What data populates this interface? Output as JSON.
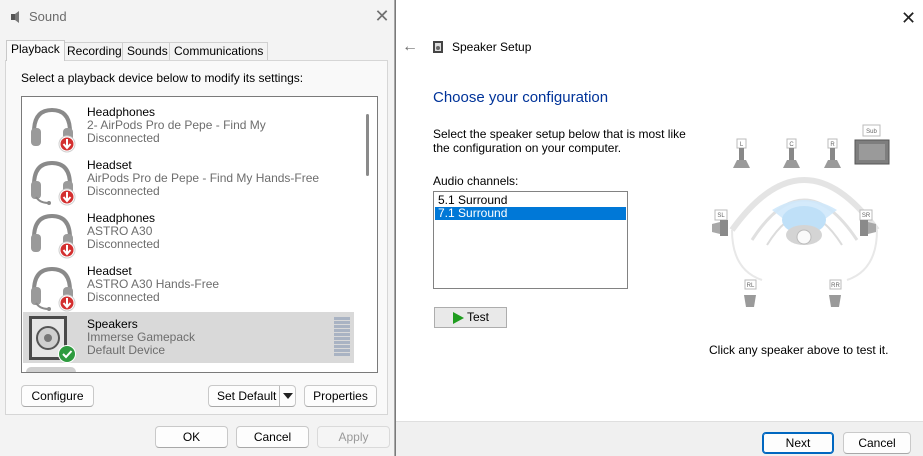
{
  "sound_dialog": {
    "title": "Sound",
    "tabs": [
      "Playback",
      "Recording",
      "Sounds",
      "Communications"
    ],
    "instruction": "Select a playback device below to modify its settings:",
    "devices": [
      {
        "name": "Headphones",
        "detail": "2- AirPods Pro de Pepe - Find My",
        "status": "Disconnected",
        "icon": "headphones-icon",
        "badge": "disconnected-badge"
      },
      {
        "name": "Headset",
        "detail": "AirPods Pro de Pepe - Find My Hands-Free",
        "status": "Disconnected",
        "icon": "headset-icon",
        "badge": "disconnected-badge"
      },
      {
        "name": "Headphones",
        "detail": "ASTRO A30",
        "status": "Disconnected",
        "icon": "headphones-icon",
        "badge": "disconnected-badge"
      },
      {
        "name": "Headset",
        "detail": "ASTRO A30 Hands-Free",
        "status": "Disconnected",
        "icon": "headset-icon",
        "badge": "disconnected-badge"
      },
      {
        "name": "Speakers",
        "detail": "Immerse Gamepack",
        "status": "Default Device",
        "icon": "speakers-icon",
        "badge": "default-check-badge",
        "selected": true
      }
    ],
    "buttons": {
      "configure": "Configure",
      "set_default": "Set Default",
      "properties": "Properties",
      "ok": "OK",
      "cancel": "Cancel",
      "apply": "Apply"
    }
  },
  "speaker_setup": {
    "header_title": "Speaker Setup",
    "heading": "Choose your configuration",
    "description": "Select the speaker setup below that is most like the configuration on your computer.",
    "channels_label": "Audio channels:",
    "channels": [
      {
        "label": "5.1 Surround",
        "selected": false
      },
      {
        "label": "7.1 Surround",
        "selected": true
      }
    ],
    "test_label": "Test",
    "hint": "Click any speaker above to test it.",
    "speaker_labels": {
      "L": "L",
      "C": "C",
      "R": "R",
      "Sub": "Sub",
      "SL": "SL",
      "SR": "SR",
      "RL": "RL",
      "RR": "RR"
    },
    "buttons": {
      "next": "Next",
      "cancel": "Cancel"
    }
  },
  "colors": {
    "heading": "#003399",
    "selection": "#0078d7",
    "accent": "#0067c0",
    "disconnect": "#d32f2f",
    "default_ok": "#2e9b3f"
  }
}
